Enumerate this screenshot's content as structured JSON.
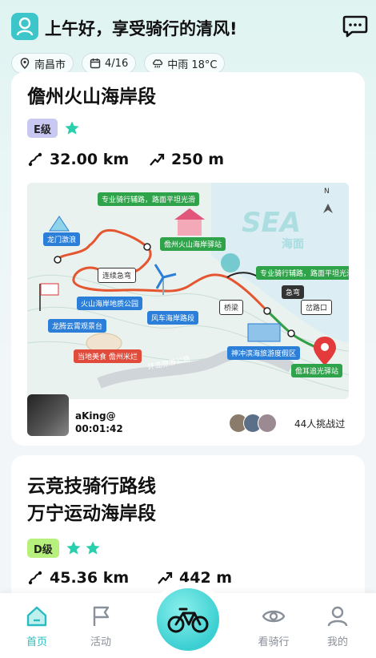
{
  "header": {
    "greeting": "上午好，享受骑行的清风!",
    "location": "南昌市",
    "date": "4/16",
    "weather": "中雨 18°C"
  },
  "routes": [
    {
      "title_lines": [
        "儋州火山海岸段"
      ],
      "level": "E级",
      "stars": 1,
      "distance": "32.00 km",
      "elevation": "250 m",
      "map_labels": {
        "top_banner": "专业骑行辅路，路面平坦光滑",
        "station1": "儋州火山海岸驿站",
        "dragon_gate": "龙门激浪",
        "turn": "连续急弯",
        "geopark": "火山海岸地质公园",
        "windmill_road": "风车海岸路段",
        "platform": "龙腾云霄观景台",
        "bridge": "桥梁",
        "right_banner": "专业骑行辅路，路面平坦光滑",
        "sharp_turn": "急弯",
        "crossing": "岔路口",
        "resort": "神冲滨海旅游度假区",
        "end_station": "儋耳追光驿站",
        "food": "当地美食 儋州米烂",
        "road": "环岛旅游公路",
        "sea_en": "SEA",
        "sea_cn": "海面",
        "north": "N"
      },
      "user": {
        "name": "aKing@",
        "time": "00:01:42"
      },
      "challengers": "44人挑战过"
    },
    {
      "title_lines": [
        "云竞技骑行路线",
        "万宁运动海岸段"
      ],
      "level": "D级",
      "stars": 2,
      "distance": "45.36 km",
      "elevation": "442 m"
    }
  ],
  "tabs": [
    {
      "label": "首页",
      "icon": "home-icon",
      "active": true
    },
    {
      "label": "活动",
      "icon": "flag-icon",
      "active": false
    },
    {
      "label": "看骑行",
      "icon": "eye-icon",
      "active": false
    },
    {
      "label": "我的",
      "icon": "profile-icon",
      "active": false
    }
  ],
  "colors": {
    "accent": "#2bbcc2",
    "level_e": "#c9c8f2",
    "level_d": "#b7f07c",
    "star": "#2ad0ae"
  }
}
